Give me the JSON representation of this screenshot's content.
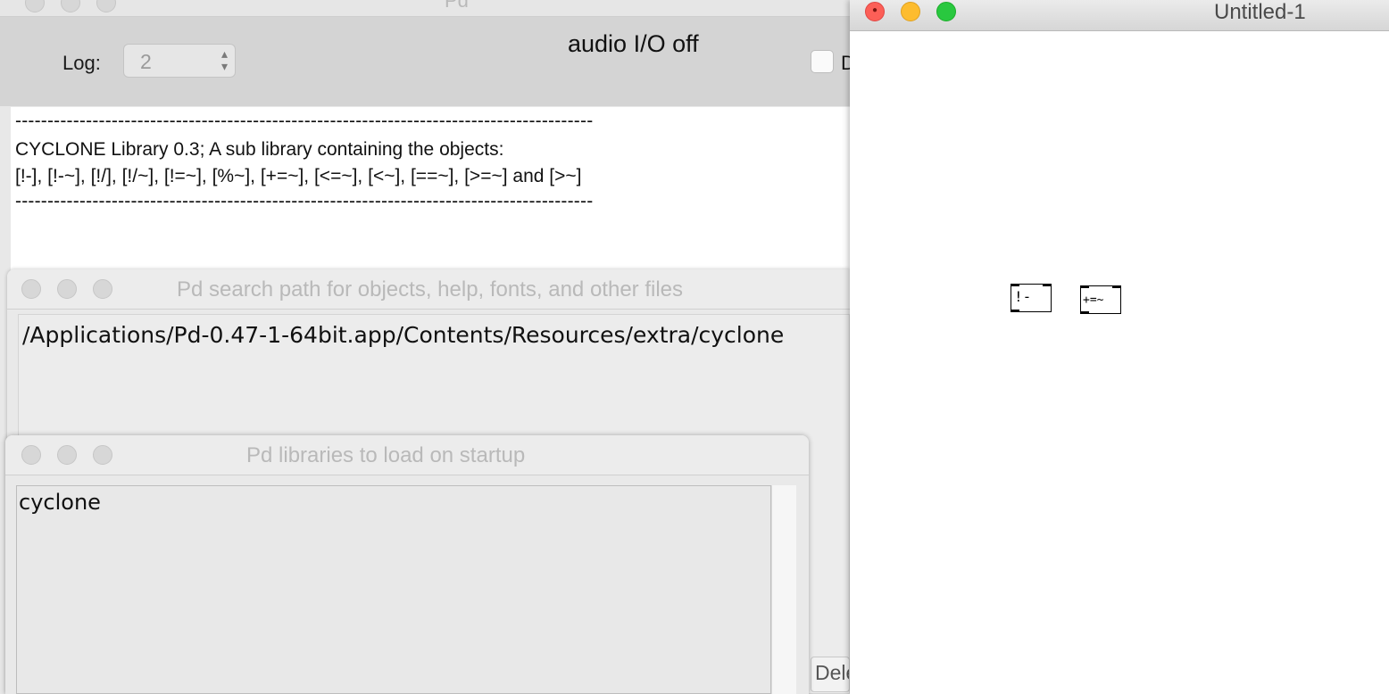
{
  "pd_main": {
    "title": "Pd",
    "log_label": "Log:",
    "log_value": "2",
    "audio_status": "audio I/O off",
    "dsp_label": "DSP",
    "console": {
      "lines": [
        "------------------------------------------------------------------------------------------",
        "CYCLONE Library 0.3; A sub library containing the objects:",
        "[!-], [!-~], [!/], [!/~], [!=~], [%~], [+=~], [<=~], [<~], [==~], [>=~] and [>~]",
        "------------------------------------------------------------------------------------------"
      ]
    }
  },
  "search_path_dialog": {
    "title": "Pd search path for objects, help, fonts, and other files",
    "paths": [
      "/Applications/Pd-0.47-1-64bit.app/Contents/Resources/extra/cyclone"
    ],
    "delete_label": "Delete"
  },
  "libraries_dialog": {
    "title": "Pd libraries to load on startup",
    "libraries": [
      "cyclone"
    ]
  },
  "patch_window": {
    "title": "Untitled-1",
    "objects": [
      {
        "text": "!-"
      },
      {
        "text": "+=~"
      }
    ]
  },
  "icons": {
    "log_stepper": "up-down-chevron-icon",
    "close": "close-icon",
    "minimize": "minimize-icon",
    "maximize": "zoom-icon"
  },
  "colors": {
    "close": "#fc5f57",
    "minimize": "#fdbc2e",
    "maximize": "#29c83f"
  }
}
